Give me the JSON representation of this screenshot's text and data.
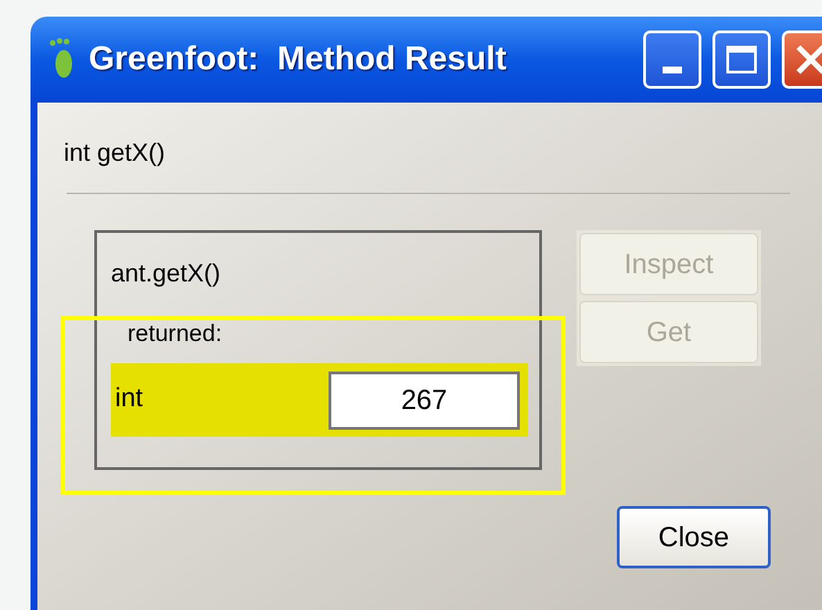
{
  "window": {
    "title": "Greenfoot:  Method Result"
  },
  "signature": "int getX()",
  "result": {
    "call": "ant.getX()",
    "returned_label": "returned:",
    "type": "int",
    "value": "267",
    "highlighted": true
  },
  "side_buttons": [
    {
      "label": "Inspect",
      "disabled": true
    },
    {
      "label": "Get",
      "disabled": true
    }
  ],
  "close_button": {
    "label": "Close",
    "focused": true
  }
}
